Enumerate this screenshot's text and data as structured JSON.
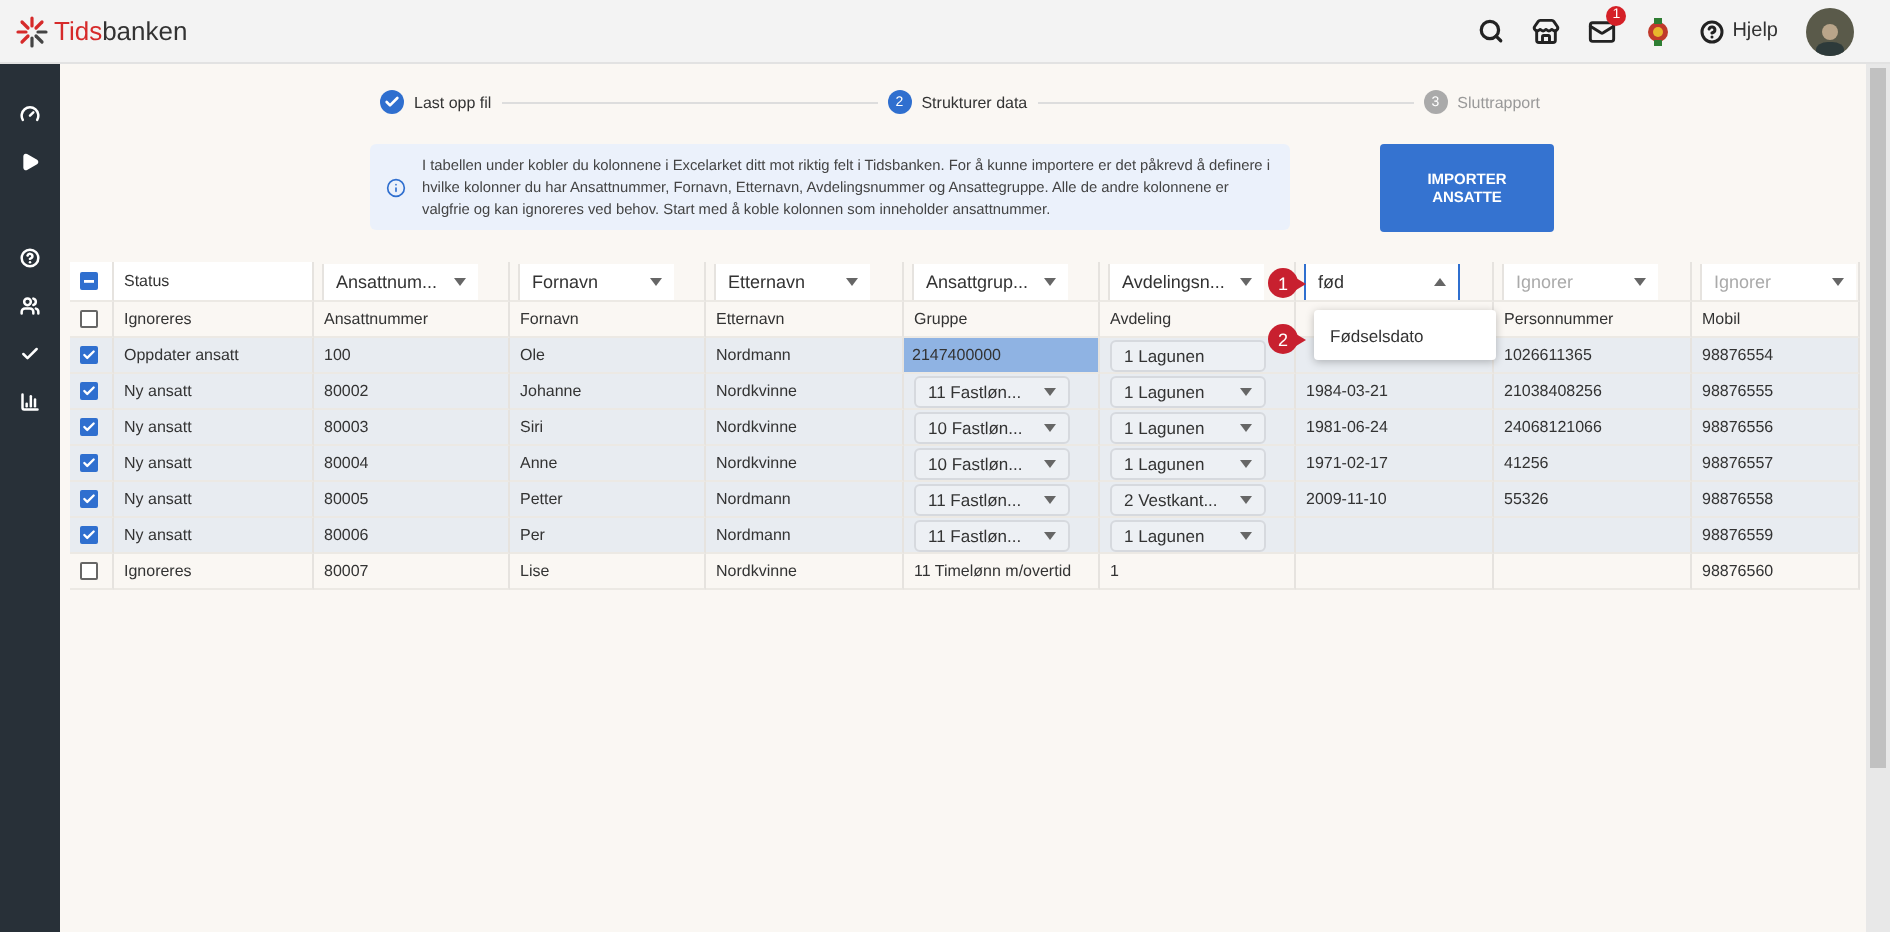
{
  "topbar": {
    "logo": {
      "accent": "Tids",
      "rest": "banken"
    },
    "mail_badge": "1",
    "help_label": "Hjelp"
  },
  "stepper": [
    {
      "label": "Last opp fil",
      "completed": true,
      "active": false
    },
    {
      "number": "2",
      "label": "Strukturer data",
      "completed": false,
      "active": true
    },
    {
      "number": "3",
      "label": "Sluttrapport",
      "completed": false,
      "active": false
    }
  ],
  "info": "I tabellen under kobler du kolonnene i Excelarket ditt mot riktig felt i Tidsbanken. For å kunne importere er det påkrevd å definere i hvilke kolonner du har Ansattnummer, Fornavn, Etternavn, Avdelingsnummer og Ansattegruppe. Alle de andre kolonnene er valgfrie og kan ignoreres ved behov. Start med å koble kolonnen som inneholder ansattnummer.",
  "import_button": "IMPORTER ANSATTE",
  "table": {
    "select_all": {
      "indeterminate": true
    },
    "status_heading": "Status",
    "column_selects": [
      {
        "value": "Ansattnum...",
        "open": false
      },
      {
        "value": "Fornavn",
        "open": false
      },
      {
        "value": "Etternavn",
        "open": false
      },
      {
        "value": "Ansattgrup...",
        "open": false
      },
      {
        "value": "Avdelingsn...",
        "open": false
      },
      {
        "value": "fød",
        "open": true
      },
      {
        "placeholder": "Ignorer",
        "open": false
      },
      {
        "placeholder": "Ignorer",
        "open": false
      }
    ],
    "dropdown_options": [
      "Fødselsdato"
    ],
    "excel_header_row": {
      "checked": false,
      "cells": [
        {
          "kind": "text",
          "text": "Ignoreres"
        },
        {
          "kind": "text",
          "text": "Ansattnummer"
        },
        {
          "kind": "text",
          "text": "Fornavn"
        },
        {
          "kind": "text",
          "text": "Etternavn"
        },
        {
          "kind": "text",
          "text": "Gruppe"
        },
        {
          "kind": "text",
          "text": "Avdeling"
        },
        {
          "kind": "empty"
        },
        {
          "kind": "text",
          "text": "Personnummer"
        },
        {
          "kind": "text",
          "text": "Mobil"
        }
      ]
    },
    "rows": [
      {
        "checked": true,
        "cells": [
          {
            "kind": "text",
            "text": "Oppdater ansatt"
          },
          {
            "kind": "text",
            "text": "100"
          },
          {
            "kind": "text",
            "text": "Ole"
          },
          {
            "kind": "text",
            "text": "Nordmann"
          },
          {
            "kind": "highlight",
            "text": "2147400000"
          },
          {
            "kind": "select",
            "text": "1 Lagunen",
            "caret": false
          },
          {
            "kind": "empty"
          },
          {
            "kind": "text",
            "text": "1026611365"
          },
          {
            "kind": "text",
            "text": "98876554"
          }
        ]
      },
      {
        "checked": true,
        "cells": [
          {
            "kind": "text",
            "text": "Ny ansatt"
          },
          {
            "kind": "text",
            "text": "80002"
          },
          {
            "kind": "text",
            "text": "Johanne"
          },
          {
            "kind": "text",
            "text": "Nordkvinne"
          },
          {
            "kind": "select",
            "text": "11 Fastløn...",
            "caret": true
          },
          {
            "kind": "select",
            "text": "1 Lagunen",
            "caret": true
          },
          {
            "kind": "text",
            "text": "1984-03-21"
          },
          {
            "kind": "text",
            "text": "21038408256"
          },
          {
            "kind": "text",
            "text": "98876555"
          }
        ]
      },
      {
        "checked": true,
        "cells": [
          {
            "kind": "text",
            "text": "Ny ansatt"
          },
          {
            "kind": "text",
            "text": "80003"
          },
          {
            "kind": "text",
            "text": "Siri"
          },
          {
            "kind": "text",
            "text": "Nordkvinne"
          },
          {
            "kind": "select",
            "text": "10 Fastløn...",
            "caret": true
          },
          {
            "kind": "select",
            "text": "1 Lagunen",
            "caret": true
          },
          {
            "kind": "text",
            "text": "1981-06-24"
          },
          {
            "kind": "text",
            "text": "24068121066"
          },
          {
            "kind": "text",
            "text": "98876556"
          }
        ]
      },
      {
        "checked": true,
        "cells": [
          {
            "kind": "text",
            "text": "Ny ansatt"
          },
          {
            "kind": "text",
            "text": "80004"
          },
          {
            "kind": "text",
            "text": "Anne"
          },
          {
            "kind": "text",
            "text": "Nordkvinne"
          },
          {
            "kind": "select",
            "text": "10 Fastløn...",
            "caret": true
          },
          {
            "kind": "select",
            "text": "1 Lagunen",
            "caret": true
          },
          {
            "kind": "text",
            "text": "1971-02-17"
          },
          {
            "kind": "text",
            "text": "41256"
          },
          {
            "kind": "text",
            "text": "98876557"
          }
        ]
      },
      {
        "checked": true,
        "cells": [
          {
            "kind": "text",
            "text": "Ny ansatt"
          },
          {
            "kind": "text",
            "text": "80005"
          },
          {
            "kind": "text",
            "text": "Petter"
          },
          {
            "kind": "text",
            "text": "Nordmann"
          },
          {
            "kind": "select",
            "text": "11 Fastløn...",
            "caret": true
          },
          {
            "kind": "select",
            "text": "2 Vestkant...",
            "caret": true
          },
          {
            "kind": "text",
            "text": "2009-11-10"
          },
          {
            "kind": "text",
            "text": "55326"
          },
          {
            "kind": "text",
            "text": "98876558"
          }
        ]
      },
      {
        "checked": true,
        "cells": [
          {
            "kind": "text",
            "text": "Ny ansatt"
          },
          {
            "kind": "text",
            "text": "80006"
          },
          {
            "kind": "text",
            "text": "Per"
          },
          {
            "kind": "text",
            "text": "Nordmann"
          },
          {
            "kind": "select",
            "text": "11 Fastløn...",
            "caret": true
          },
          {
            "kind": "select",
            "text": "1 Lagunen",
            "caret": true
          },
          {
            "kind": "empty"
          },
          {
            "kind": "empty"
          },
          {
            "kind": "text",
            "text": "98876559"
          }
        ]
      },
      {
        "checked": false,
        "cells": [
          {
            "kind": "text",
            "text": "Ignoreres"
          },
          {
            "kind": "text",
            "text": "80007"
          },
          {
            "kind": "text",
            "text": "Lise"
          },
          {
            "kind": "text",
            "text": "Nordkvinne"
          },
          {
            "kind": "text",
            "text": "11 Timelønn m/overtid"
          },
          {
            "kind": "text",
            "text": "1"
          },
          {
            "kind": "empty"
          },
          {
            "kind": "empty"
          },
          {
            "kind": "text",
            "text": "98876560"
          }
        ]
      }
    ]
  },
  "callouts": [
    "1",
    "2"
  ]
}
